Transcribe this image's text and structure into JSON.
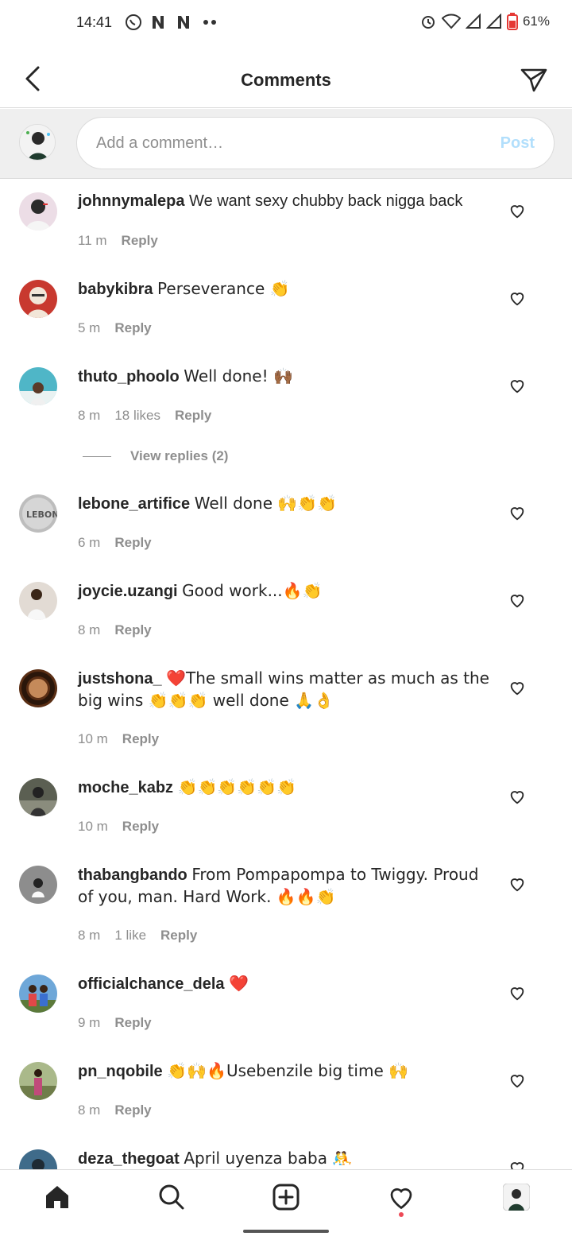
{
  "status_bar": {
    "time": "14:41",
    "battery": "61%",
    "left_icons": [
      "whatsapp-icon",
      "netflix-icon",
      "netflix-icon",
      "more-dots-icon"
    ],
    "right_icons": [
      "alarm-icon",
      "wifi-icon",
      "signal-icon",
      "signal-icon",
      "battery-icon"
    ]
  },
  "header": {
    "title": "Comments"
  },
  "composer": {
    "placeholder": "Add a comment…",
    "post_label": "Post",
    "post_color": "#b2dffc"
  },
  "comments": [
    {
      "username": "johnnymalepa",
      "text": "We want sexy chubby back nigga back",
      "time": "11 m",
      "likes": "",
      "reply": "Reply",
      "avatar_color": "#e8d6e0"
    },
    {
      "username": "babykibra",
      "text": "Perseverance 👏",
      "time": "5 m",
      "likes": "",
      "reply": "Reply",
      "avatar_color": "#c8392f"
    },
    {
      "username": "thuto_phoolo",
      "text": "Well done! 🙌🏾",
      "time": "8 m",
      "likes": "18 likes",
      "reply": "Reply",
      "avatar_color": "#4fb6c7"
    },
    {
      "username": "lebone_artifice",
      "text": "Well done 🙌👏👏",
      "time": "6 m",
      "likes": "",
      "reply": "Reply",
      "avatar_color": "#b9b9b9"
    },
    {
      "username": "joycie.uzangi",
      "text": "Good work...🔥👏",
      "time": "8 m",
      "likes": "",
      "reply": "Reply",
      "avatar_color": "#d8cfc7"
    },
    {
      "username": "justshona_",
      "text": "❤️The small wins matter as much as the big wins 👏👏👏 well done 🙏👌",
      "time": "10 m",
      "likes": "",
      "reply": "Reply",
      "avatar_color": "#6b3a1f"
    },
    {
      "username": "moche_kabz",
      "text": "👏👏👏👏👏👏",
      "time": "10 m",
      "likes": "",
      "reply": "Reply",
      "avatar_color": "#5b5f52"
    },
    {
      "username": "thabangbando",
      "text": "From Pompapompa to Twiggy. Proud of you, man. Hard Work. 🔥🔥👏",
      "time": "8 m",
      "likes": "1 like",
      "reply": "Reply",
      "avatar_color": "#8d8d8d"
    },
    {
      "username": "officialchance_dela",
      "text": "❤️",
      "time": "9 m",
      "likes": "",
      "reply": "Reply",
      "avatar_color": "#5a8fc8"
    },
    {
      "username": "pn_nqobile",
      "text": "👏🙌🔥Usebenzile big time 🙌",
      "time": "8 m",
      "likes": "",
      "reply": "Reply",
      "avatar_color": "#7d8a5a"
    },
    {
      "username": "deza_thegoat",
      "text": "April uyenza baba 🤼",
      "time": "",
      "likes": "",
      "reply": "",
      "avatar_color": "#3f6b8a"
    }
  ],
  "view_replies": "View replies (2)",
  "nav": {
    "items": [
      "home-icon",
      "search-icon",
      "add-post-icon",
      "activity-icon",
      "profile-avatar"
    ],
    "notification_color": "#ed4956"
  }
}
